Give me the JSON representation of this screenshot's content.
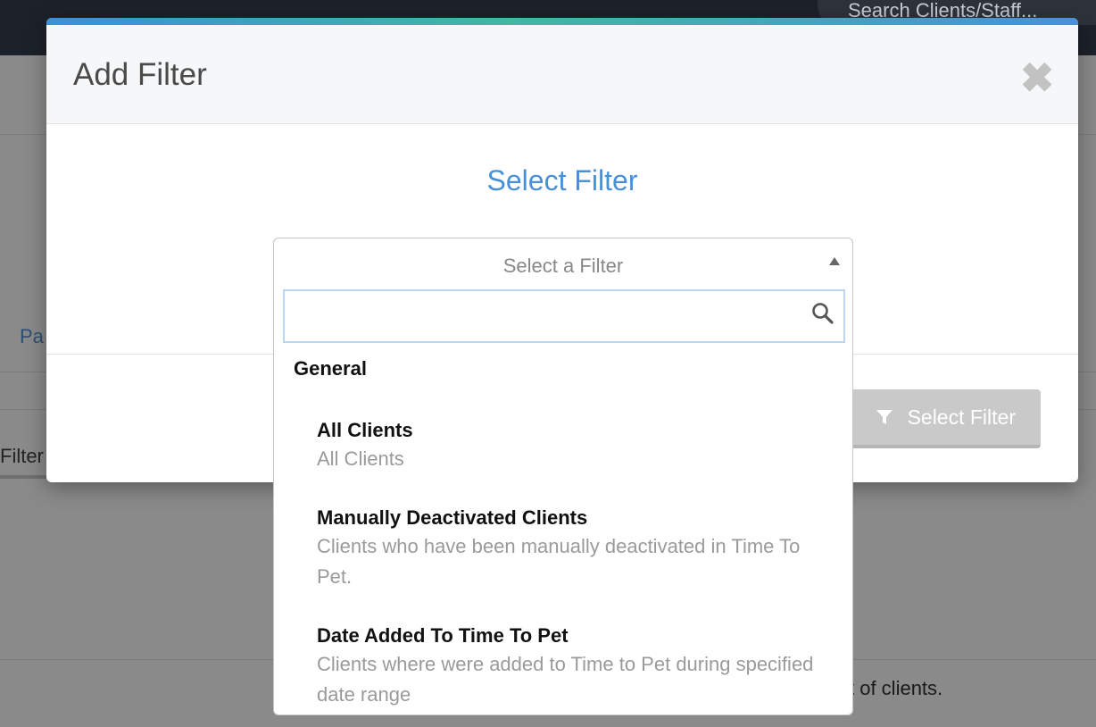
{
  "background": {
    "search_placeholder": "Search Clients/Staff...",
    "partial_link": "Pa",
    "filter_tab": "Filter",
    "partial_text": "st of clients."
  },
  "modal": {
    "title": "Add Filter",
    "close_symbol": "✖",
    "heading": "Select Filter",
    "footer_button_label": "Select Filter"
  },
  "select": {
    "placeholder": "Select a Filter",
    "search_value": "",
    "group_label": "General",
    "options": [
      {
        "title": "All Clients",
        "description": "All Clients"
      },
      {
        "title": "Manually Deactivated Clients",
        "description": "Clients who have been manually deactivated in Time To Pet."
      },
      {
        "title": "Date Added To Time To Pet",
        "description": "Clients where were added to Time to Pet during specified date range"
      }
    ]
  },
  "colors": {
    "accent": "#4a90d9",
    "accent_gradient_mid": "#42b7a2",
    "disabled_button": "#c9c9c9"
  }
}
